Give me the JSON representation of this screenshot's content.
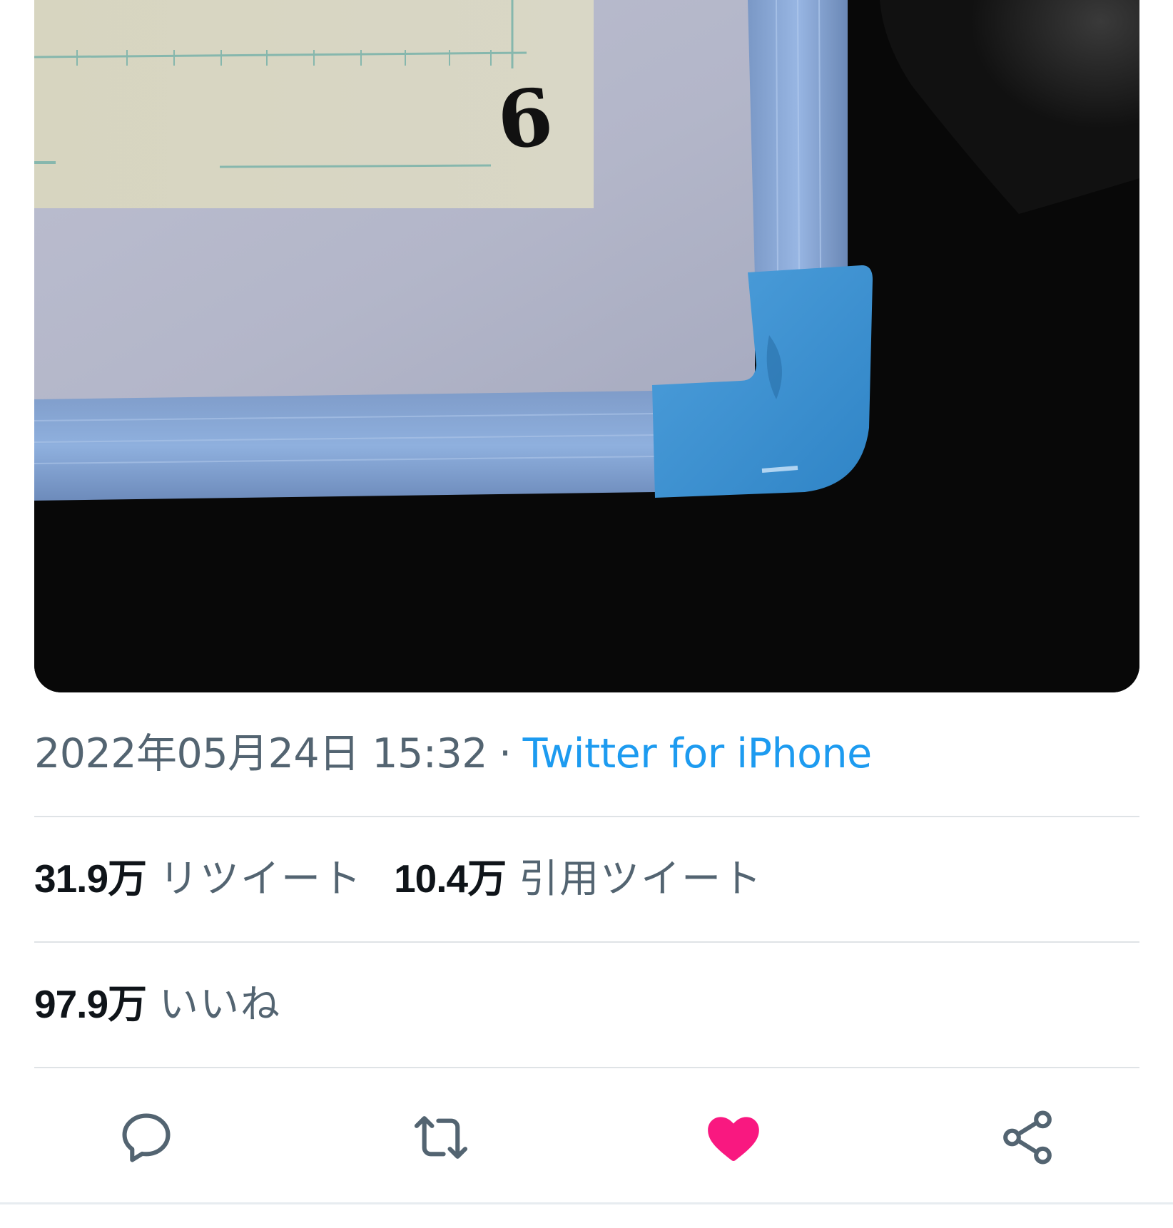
{
  "tweet": {
    "timestamp": "2022年05月24日 15:32",
    "separator": "·",
    "source": "Twitter for iPhone",
    "photo": {
      "description_icon": "photo-whiteboard-corner",
      "visible_text": "6"
    }
  },
  "stats": {
    "retweets": {
      "count": "31.9万",
      "label": "リツイート"
    },
    "quotes": {
      "count": "10.4万",
      "label": "引用ツイート"
    },
    "likes": {
      "count": "97.9万",
      "label": "いいね"
    }
  },
  "actions": {
    "reply": {
      "icon": "reply-icon"
    },
    "retweet": {
      "icon": "retweet-icon"
    },
    "like": {
      "icon": "heart-icon",
      "active": true
    },
    "share": {
      "icon": "share-icon"
    }
  },
  "colors": {
    "accent": "#1d9bf0",
    "like_active": "#f91880",
    "secondary_text": "#536471",
    "primary_text": "#0f1419",
    "divider": "#dfe3e6"
  }
}
